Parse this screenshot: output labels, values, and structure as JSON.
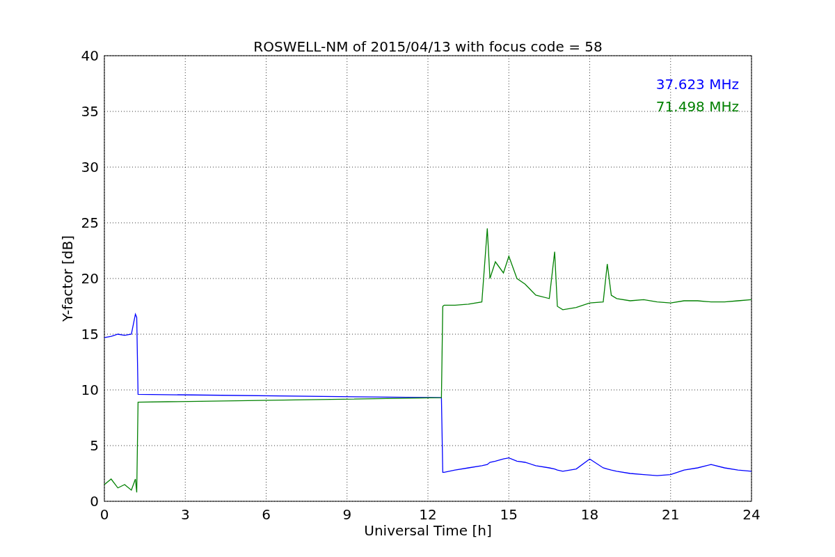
{
  "chart_data": {
    "type": "line",
    "title": "ROSWELL-NM of 2015/04/13 with focus code = 58",
    "xlabel": "Universal Time [h]",
    "ylabel": "Y-factor [dB]",
    "x": [
      0,
      0.25,
      0.5,
      0.75,
      1.0,
      1.15,
      1.2,
      1.25,
      12.5,
      12.55,
      12.6,
      13,
      13.5,
      14,
      14.2,
      14.3,
      14.5,
      14.8,
      15,
      15.3,
      15.6,
      16,
      16.5,
      16.7,
      16.8,
      17,
      17.5,
      18,
      18.5,
      18.65,
      18.8,
      19,
      19.5,
      20,
      20.5,
      21,
      21.5,
      22,
      22.5,
      23,
      23.5,
      24
    ],
    "series": [
      {
        "name": "37.623 MHz",
        "color": "#0000ff",
        "values": [
          14.7,
          14.8,
          15.0,
          14.9,
          15.0,
          16.8,
          16.5,
          9.6,
          9.3,
          2.6,
          2.6,
          2.8,
          3.0,
          3.2,
          3.3,
          3.5,
          3.6,
          3.8,
          3.9,
          3.6,
          3.5,
          3.2,
          3.0,
          2.9,
          2.8,
          2.7,
          2.9,
          3.8,
          3.0,
          2.9,
          2.8,
          2.7,
          2.5,
          2.4,
          2.3,
          2.4,
          2.8,
          3.0,
          3.3,
          3.0,
          2.8,
          2.7
        ]
      },
      {
        "name": "71.498 MHz",
        "color": "#008000",
        "values": [
          1.5,
          2.0,
          1.2,
          1.5,
          1.0,
          2.0,
          0.8,
          8.9,
          9.3,
          17.5,
          17.6,
          17.6,
          17.7,
          17.9,
          24.5,
          20.0,
          21.5,
          20.5,
          22.0,
          20.0,
          19.5,
          18.5,
          18.2,
          22.4,
          17.5,
          17.2,
          17.4,
          17.8,
          17.9,
          21.3,
          18.5,
          18.2,
          18.0,
          18.1,
          17.9,
          17.8,
          18.0,
          18.0,
          17.9,
          17.9,
          18.0,
          18.1
        ]
      }
    ],
    "xlim": [
      0,
      24
    ],
    "ylim": [
      0,
      40
    ],
    "xticks": [
      0,
      3,
      6,
      9,
      12,
      15,
      18,
      21,
      24
    ],
    "yticks": [
      0,
      5,
      10,
      15,
      20,
      25,
      30,
      35,
      40
    ],
    "grid": true
  }
}
